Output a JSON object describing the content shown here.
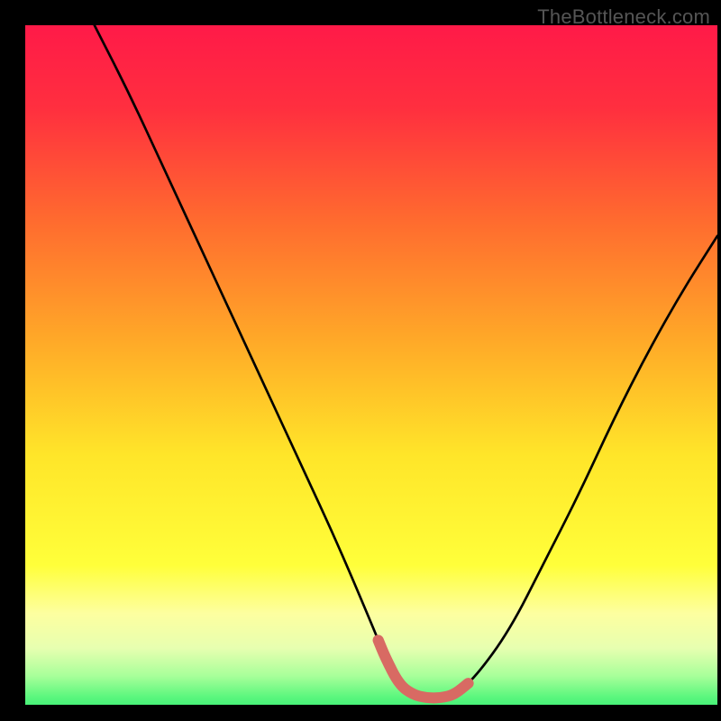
{
  "watermark": "TheBottleneck.com",
  "colors": {
    "gradient_stops": [
      {
        "offset": 0.0,
        "color": "#ff1a48"
      },
      {
        "offset": 0.12,
        "color": "#ff2f3f"
      },
      {
        "offset": 0.28,
        "color": "#ff6a2f"
      },
      {
        "offset": 0.45,
        "color": "#ffa728"
      },
      {
        "offset": 0.62,
        "color": "#ffe529"
      },
      {
        "offset": 0.78,
        "color": "#ffff3a"
      },
      {
        "offset": 0.85,
        "color": "#fdffa0"
      },
      {
        "offset": 0.9,
        "color": "#e7ffb0"
      },
      {
        "offset": 0.94,
        "color": "#a8ff9a"
      },
      {
        "offset": 0.97,
        "color": "#5cf77e"
      },
      {
        "offset": 1.0,
        "color": "#29e86f"
      }
    ],
    "curve_stroke": "#000000",
    "highlight_stroke": "#d86a63",
    "background": "#000000"
  },
  "chart_data": {
    "type": "line",
    "title": "",
    "xlabel": "",
    "ylabel": "",
    "xlim": [
      0,
      100
    ],
    "ylim": [
      0,
      100
    ],
    "series": [
      {
        "name": "bottleneck-curve",
        "x": [
          10,
          15,
          20,
          25,
          30,
          35,
          40,
          45,
          50,
          52,
          54,
          56,
          58,
          60,
          62,
          65,
          70,
          75,
          80,
          85,
          90,
          95,
          100
        ],
        "y": [
          100,
          90,
          79,
          68,
          57,
          46,
          35,
          24,
          12,
          7,
          3,
          1.5,
          1,
          1,
          1.5,
          4,
          11,
          21,
          31,
          42,
          52,
          61,
          69
        ]
      }
    ],
    "highlight": {
      "name": "bottleneck-trough",
      "x_range": [
        51,
        64
      ],
      "y": 2
    }
  }
}
